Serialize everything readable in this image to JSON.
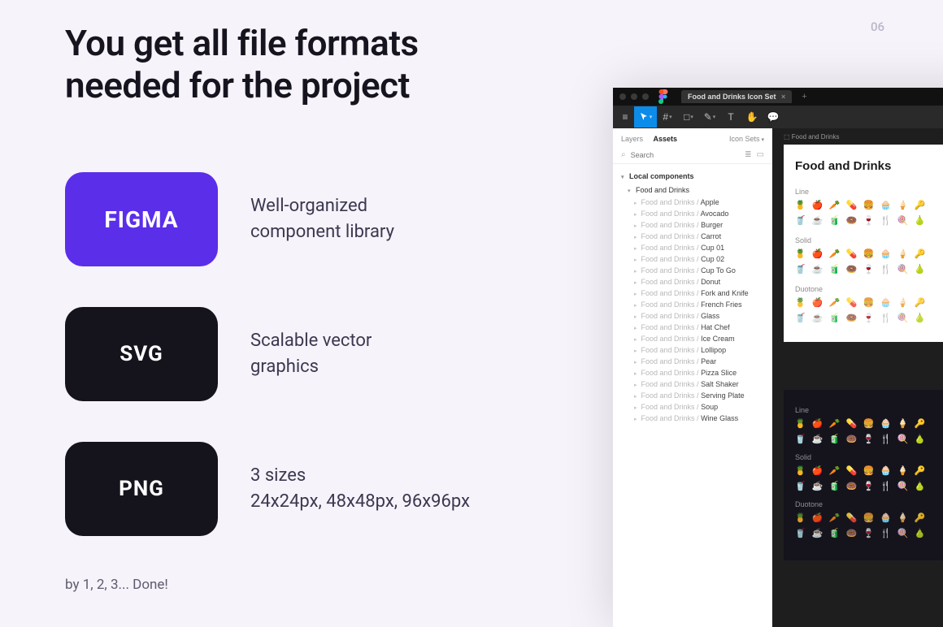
{
  "page_number": "06",
  "headline_l1": "You get all file formats",
  "headline_l2": "needed for the project",
  "formats": {
    "figma": {
      "label": "FIGMA",
      "desc1": "Well-organized",
      "desc2": "component library"
    },
    "svg": {
      "label": "SVG",
      "desc1": "Scalable vector",
      "desc2": "graphics"
    },
    "png": {
      "label": "PNG",
      "desc1": "3 sizes",
      "desc2": "24x24px, 48x48px, 96x96px"
    }
  },
  "byline": "by 1, 2, 3... Done!",
  "figma_mock": {
    "tab_title": "Food and Drinks Icon Set",
    "side_tabs": {
      "layers": "Layers",
      "assets": "Assets",
      "page": "Icon Sets"
    },
    "search_placeholder": "Search",
    "group_local": "Local components",
    "group_main": "Food and Drinks",
    "item_prefix": "Food and Drinks / ",
    "items": [
      "Apple",
      "Avocado",
      "Burger",
      "Carrot",
      "Cup 01",
      "Cup 02",
      "Cup To Go",
      "Donut",
      "Fork and Knife",
      "French Fries",
      "Glass",
      "Hat Chef",
      "Ice Cream",
      "Lollipop",
      "Pear",
      "Pizza Slice",
      "Salt Shaker",
      "Serving Plate",
      "Soup",
      "Wine Glass"
    ],
    "canvas": {
      "frame_label": "Food and Drinks",
      "artboard_title": "Food and Drinks",
      "sections": {
        "line": "Line",
        "solid": "Solid",
        "duotone": "Duotone"
      }
    }
  }
}
